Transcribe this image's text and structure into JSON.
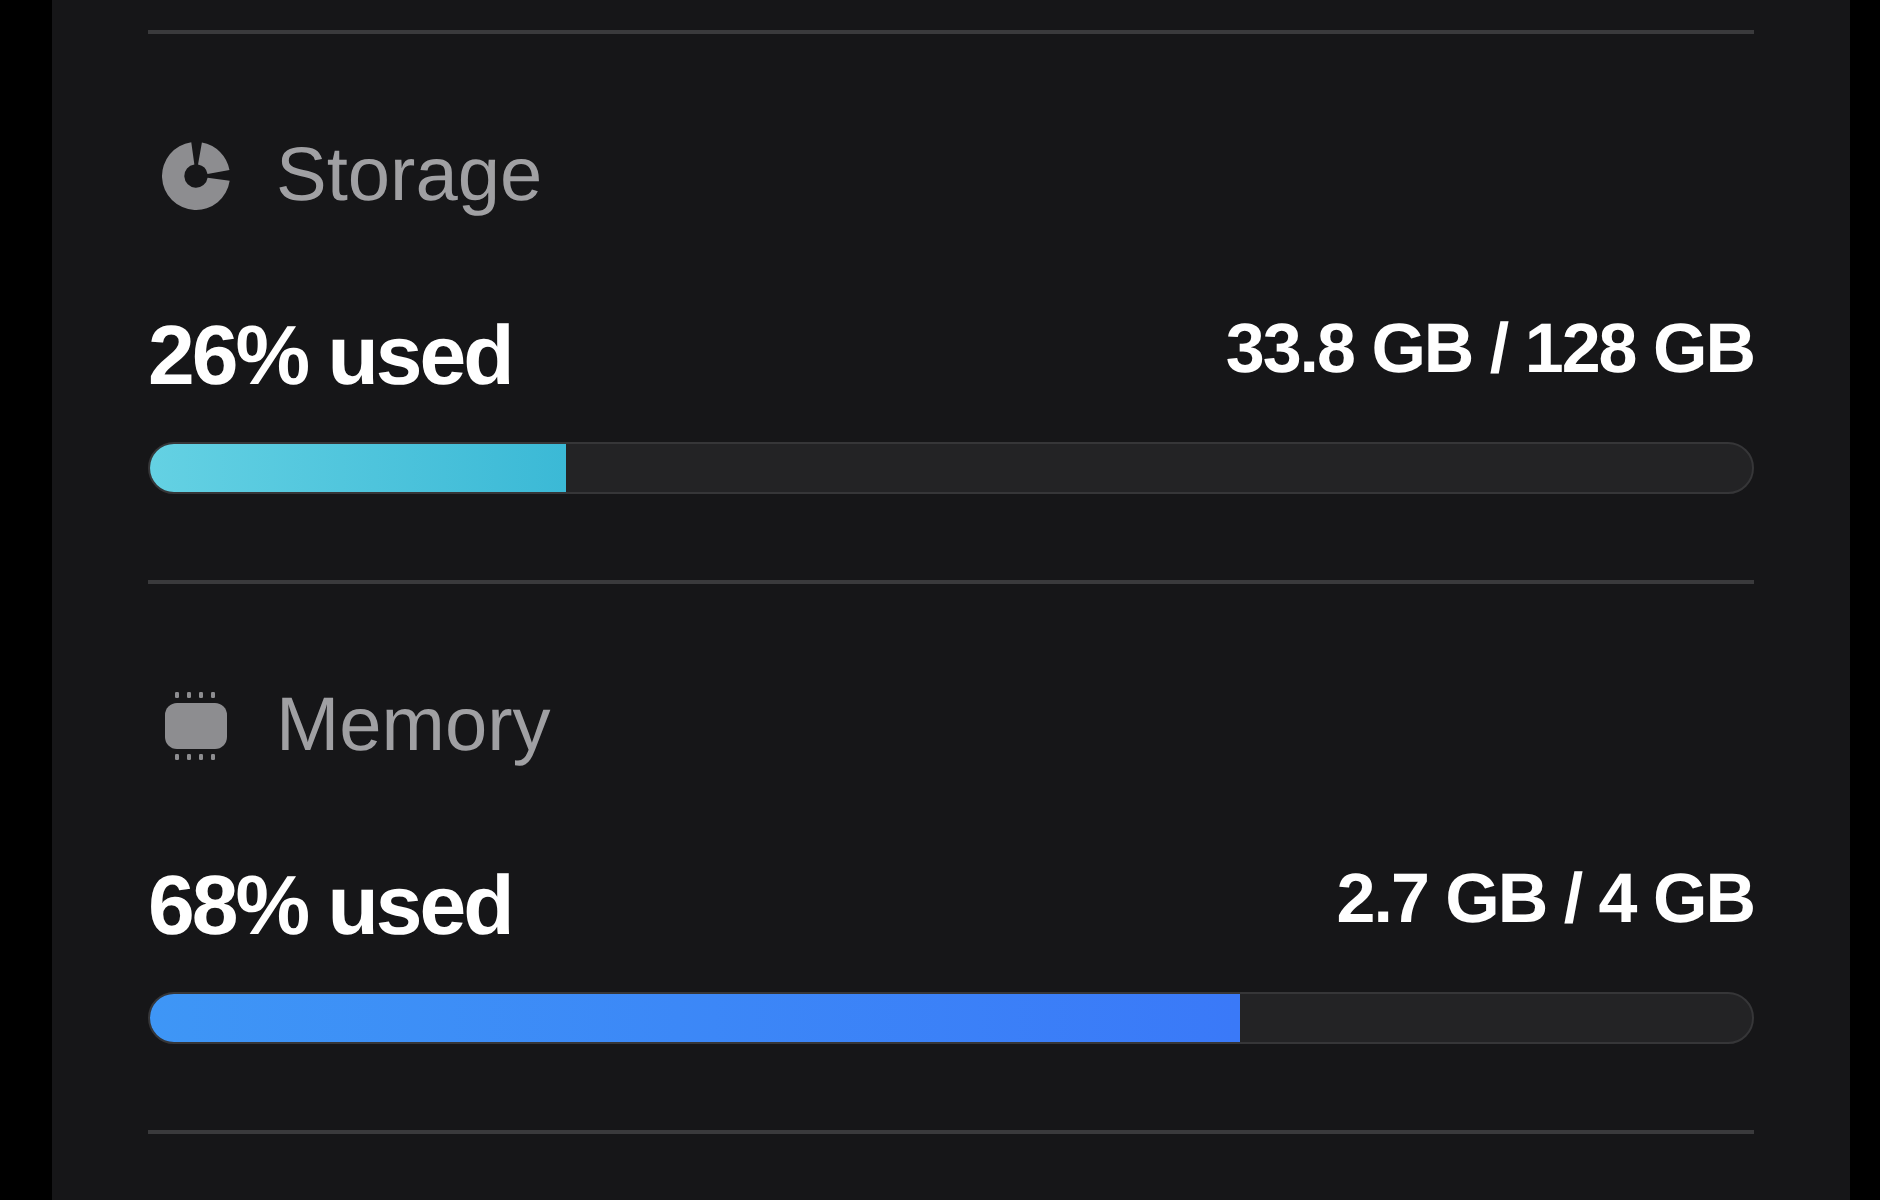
{
  "sections": [
    {
      "kind": "storage",
      "title": "Storage",
      "used_label": "26% used",
      "amount": "33.8 GB / 128 GB",
      "level": 0.26
    },
    {
      "kind": "memory",
      "title": "Memory",
      "used_label": "68% used",
      "amount": "2.7 GB / 4 GB",
      "level": 0.68
    }
  ]
}
